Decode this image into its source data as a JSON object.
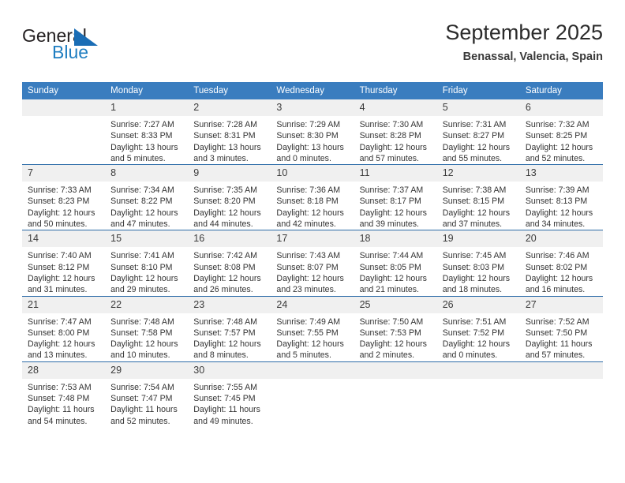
{
  "brand": {
    "name_part1": "General",
    "name_part2": "Blue",
    "logo_icon": "triangle-logo-icon",
    "accent_color": "#1a6db5"
  },
  "header": {
    "title": "September 2025",
    "subtitle": "Benassal, Valencia, Spain"
  },
  "calendar": {
    "header_bg": "#3a7dbf",
    "row_divider_color": "#2d6ca8",
    "daynum_bg": "#f0f0f0",
    "weekday_headers": [
      "Sunday",
      "Monday",
      "Tuesday",
      "Wednesday",
      "Thursday",
      "Friday",
      "Saturday"
    ],
    "weeks": [
      [
        {
          "day": "",
          "sunrise": "",
          "sunset": "",
          "daylight1": "",
          "daylight2": ""
        },
        {
          "day": "1",
          "sunrise": "Sunrise: 7:27 AM",
          "sunset": "Sunset: 8:33 PM",
          "daylight1": "Daylight: 13 hours",
          "daylight2": "and 5 minutes."
        },
        {
          "day": "2",
          "sunrise": "Sunrise: 7:28 AM",
          "sunset": "Sunset: 8:31 PM",
          "daylight1": "Daylight: 13 hours",
          "daylight2": "and 3 minutes."
        },
        {
          "day": "3",
          "sunrise": "Sunrise: 7:29 AM",
          "sunset": "Sunset: 8:30 PM",
          "daylight1": "Daylight: 13 hours",
          "daylight2": "and 0 minutes."
        },
        {
          "day": "4",
          "sunrise": "Sunrise: 7:30 AM",
          "sunset": "Sunset: 8:28 PM",
          "daylight1": "Daylight: 12 hours",
          "daylight2": "and 57 minutes."
        },
        {
          "day": "5",
          "sunrise": "Sunrise: 7:31 AM",
          "sunset": "Sunset: 8:27 PM",
          "daylight1": "Daylight: 12 hours",
          "daylight2": "and 55 minutes."
        },
        {
          "day": "6",
          "sunrise": "Sunrise: 7:32 AM",
          "sunset": "Sunset: 8:25 PM",
          "daylight1": "Daylight: 12 hours",
          "daylight2": "and 52 minutes."
        }
      ],
      [
        {
          "day": "7",
          "sunrise": "Sunrise: 7:33 AM",
          "sunset": "Sunset: 8:23 PM",
          "daylight1": "Daylight: 12 hours",
          "daylight2": "and 50 minutes."
        },
        {
          "day": "8",
          "sunrise": "Sunrise: 7:34 AM",
          "sunset": "Sunset: 8:22 PM",
          "daylight1": "Daylight: 12 hours",
          "daylight2": "and 47 minutes."
        },
        {
          "day": "9",
          "sunrise": "Sunrise: 7:35 AM",
          "sunset": "Sunset: 8:20 PM",
          "daylight1": "Daylight: 12 hours",
          "daylight2": "and 44 minutes."
        },
        {
          "day": "10",
          "sunrise": "Sunrise: 7:36 AM",
          "sunset": "Sunset: 8:18 PM",
          "daylight1": "Daylight: 12 hours",
          "daylight2": "and 42 minutes."
        },
        {
          "day": "11",
          "sunrise": "Sunrise: 7:37 AM",
          "sunset": "Sunset: 8:17 PM",
          "daylight1": "Daylight: 12 hours",
          "daylight2": "and 39 minutes."
        },
        {
          "day": "12",
          "sunrise": "Sunrise: 7:38 AM",
          "sunset": "Sunset: 8:15 PM",
          "daylight1": "Daylight: 12 hours",
          "daylight2": "and 37 minutes."
        },
        {
          "day": "13",
          "sunrise": "Sunrise: 7:39 AM",
          "sunset": "Sunset: 8:13 PM",
          "daylight1": "Daylight: 12 hours",
          "daylight2": "and 34 minutes."
        }
      ],
      [
        {
          "day": "14",
          "sunrise": "Sunrise: 7:40 AM",
          "sunset": "Sunset: 8:12 PM",
          "daylight1": "Daylight: 12 hours",
          "daylight2": "and 31 minutes."
        },
        {
          "day": "15",
          "sunrise": "Sunrise: 7:41 AM",
          "sunset": "Sunset: 8:10 PM",
          "daylight1": "Daylight: 12 hours",
          "daylight2": "and 29 minutes."
        },
        {
          "day": "16",
          "sunrise": "Sunrise: 7:42 AM",
          "sunset": "Sunset: 8:08 PM",
          "daylight1": "Daylight: 12 hours",
          "daylight2": "and 26 minutes."
        },
        {
          "day": "17",
          "sunrise": "Sunrise: 7:43 AM",
          "sunset": "Sunset: 8:07 PM",
          "daylight1": "Daylight: 12 hours",
          "daylight2": "and 23 minutes."
        },
        {
          "day": "18",
          "sunrise": "Sunrise: 7:44 AM",
          "sunset": "Sunset: 8:05 PM",
          "daylight1": "Daylight: 12 hours",
          "daylight2": "and 21 minutes."
        },
        {
          "day": "19",
          "sunrise": "Sunrise: 7:45 AM",
          "sunset": "Sunset: 8:03 PM",
          "daylight1": "Daylight: 12 hours",
          "daylight2": "and 18 minutes."
        },
        {
          "day": "20",
          "sunrise": "Sunrise: 7:46 AM",
          "sunset": "Sunset: 8:02 PM",
          "daylight1": "Daylight: 12 hours",
          "daylight2": "and 16 minutes."
        }
      ],
      [
        {
          "day": "21",
          "sunrise": "Sunrise: 7:47 AM",
          "sunset": "Sunset: 8:00 PM",
          "daylight1": "Daylight: 12 hours",
          "daylight2": "and 13 minutes."
        },
        {
          "day": "22",
          "sunrise": "Sunrise: 7:48 AM",
          "sunset": "Sunset: 7:58 PM",
          "daylight1": "Daylight: 12 hours",
          "daylight2": "and 10 minutes."
        },
        {
          "day": "23",
          "sunrise": "Sunrise: 7:48 AM",
          "sunset": "Sunset: 7:57 PM",
          "daylight1": "Daylight: 12 hours",
          "daylight2": "and 8 minutes."
        },
        {
          "day": "24",
          "sunrise": "Sunrise: 7:49 AM",
          "sunset": "Sunset: 7:55 PM",
          "daylight1": "Daylight: 12 hours",
          "daylight2": "and 5 minutes."
        },
        {
          "day": "25",
          "sunrise": "Sunrise: 7:50 AM",
          "sunset": "Sunset: 7:53 PM",
          "daylight1": "Daylight: 12 hours",
          "daylight2": "and 2 minutes."
        },
        {
          "day": "26",
          "sunrise": "Sunrise: 7:51 AM",
          "sunset": "Sunset: 7:52 PM",
          "daylight1": "Daylight: 12 hours",
          "daylight2": "and 0 minutes."
        },
        {
          "day": "27",
          "sunrise": "Sunrise: 7:52 AM",
          "sunset": "Sunset: 7:50 PM",
          "daylight1": "Daylight: 11 hours",
          "daylight2": "and 57 minutes."
        }
      ],
      [
        {
          "day": "28",
          "sunrise": "Sunrise: 7:53 AM",
          "sunset": "Sunset: 7:48 PM",
          "daylight1": "Daylight: 11 hours",
          "daylight2": "and 54 minutes."
        },
        {
          "day": "29",
          "sunrise": "Sunrise: 7:54 AM",
          "sunset": "Sunset: 7:47 PM",
          "daylight1": "Daylight: 11 hours",
          "daylight2": "and 52 minutes."
        },
        {
          "day": "30",
          "sunrise": "Sunrise: 7:55 AM",
          "sunset": "Sunset: 7:45 PM",
          "daylight1": "Daylight: 11 hours",
          "daylight2": "and 49 minutes."
        },
        {
          "day": "",
          "sunrise": "",
          "sunset": "",
          "daylight1": "",
          "daylight2": ""
        },
        {
          "day": "",
          "sunrise": "",
          "sunset": "",
          "daylight1": "",
          "daylight2": ""
        },
        {
          "day": "",
          "sunrise": "",
          "sunset": "",
          "daylight1": "",
          "daylight2": ""
        },
        {
          "day": "",
          "sunrise": "",
          "sunset": "",
          "daylight1": "",
          "daylight2": ""
        }
      ]
    ]
  }
}
